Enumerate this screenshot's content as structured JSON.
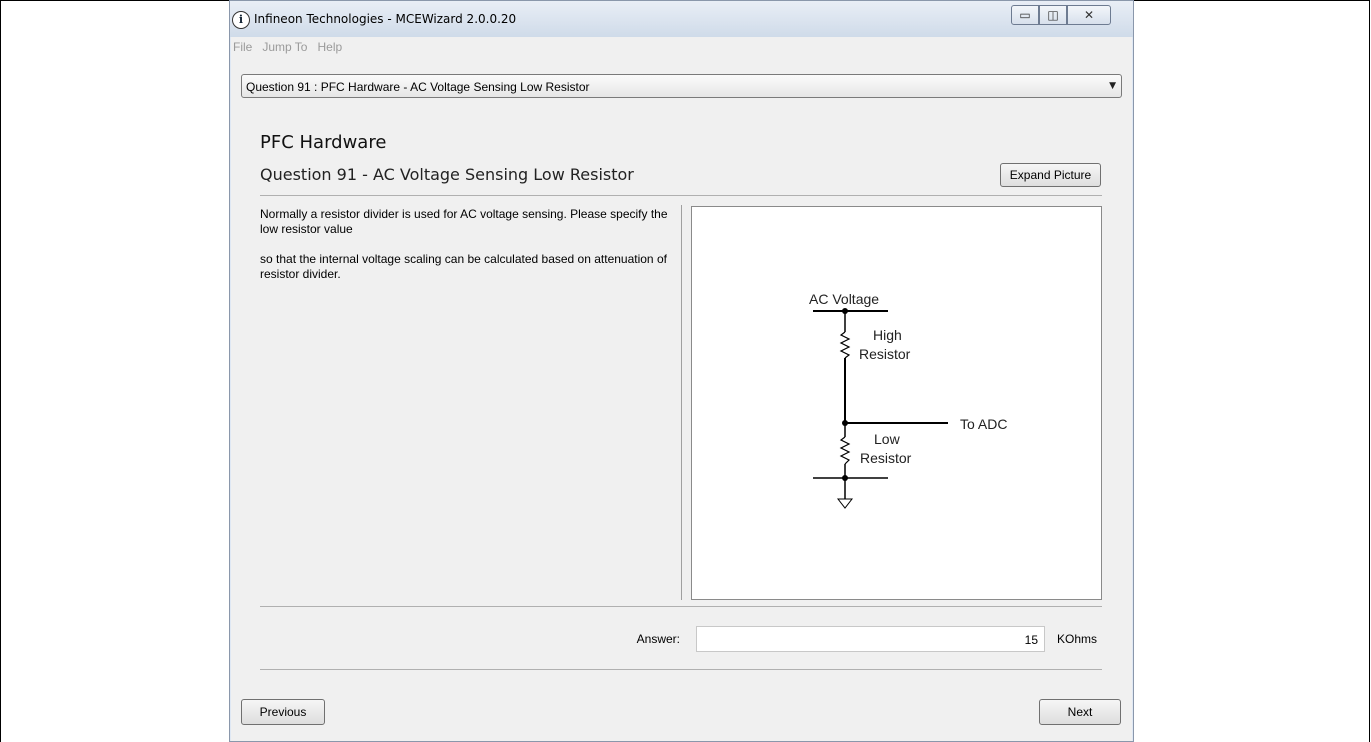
{
  "window": {
    "title": "Infineon Technologies - MCEWizard 2.0.0.20",
    "icon": "info-icon",
    "controls": {
      "minimize": "minimize-icon",
      "maximize": "maximize-icon",
      "close": "close-icon"
    }
  },
  "menu": {
    "items": [
      "File",
      "Jump To",
      "Help"
    ]
  },
  "question_selector": {
    "selected": "Question  91 : PFC Hardware - AC Voltage Sensing Low Resistor"
  },
  "content": {
    "section_title": "PFC Hardware",
    "question_title": "Question 91  -  AC Voltage Sensing Low Resistor",
    "expand_button": "Expand Picture",
    "description": [
      "Normally a resistor divider is used for AC voltage sensing. Please specify the low resistor value",
      "so that the internal voltage scaling can be calculated based on attenuation of resistor divider."
    ]
  },
  "diagram": {
    "label_ac_voltage": "AC Voltage",
    "label_high": "High",
    "label_high_resistor": "Resistor",
    "label_to_adc": "To ADC",
    "label_low": "Low",
    "label_low_resistor": "Resistor"
  },
  "answer": {
    "label": "Answer:",
    "value": "15",
    "unit": "KOhms"
  },
  "navigation": {
    "previous": "Previous",
    "next": "Next"
  }
}
